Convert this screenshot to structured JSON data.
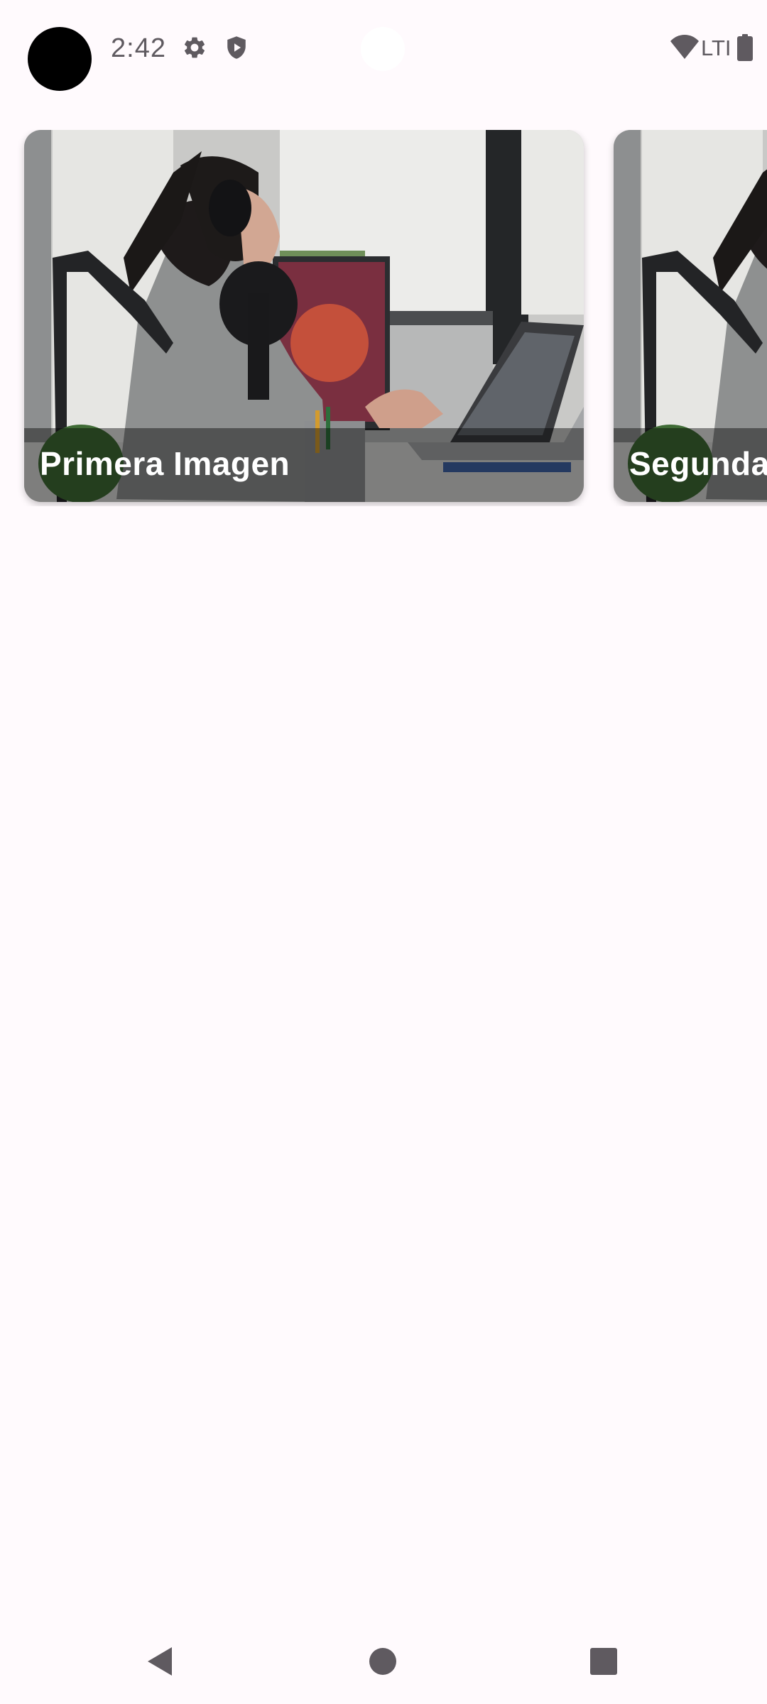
{
  "status_bar": {
    "time": "2:42",
    "network": "LTI",
    "icons": [
      "camera-dot",
      "gear-icon",
      "shield-icon",
      "wifi-icon",
      "battery-icon"
    ],
    "icon_color": "#5f5a60"
  },
  "carousel": {
    "cards": [
      {
        "title": "Primera Imagen",
        "image": "podcaster-at-desk-photo"
      },
      {
        "title": "Segunda Imagen",
        "image": "podcaster-at-desk-photo"
      }
    ]
  },
  "nav_bar": {
    "icons": [
      "back-icon",
      "home-icon",
      "recents-icon"
    ],
    "icon_color": "#5f5a60"
  },
  "colors": {
    "background": "#fffafd",
    "caption_overlay": "#000000"
  }
}
